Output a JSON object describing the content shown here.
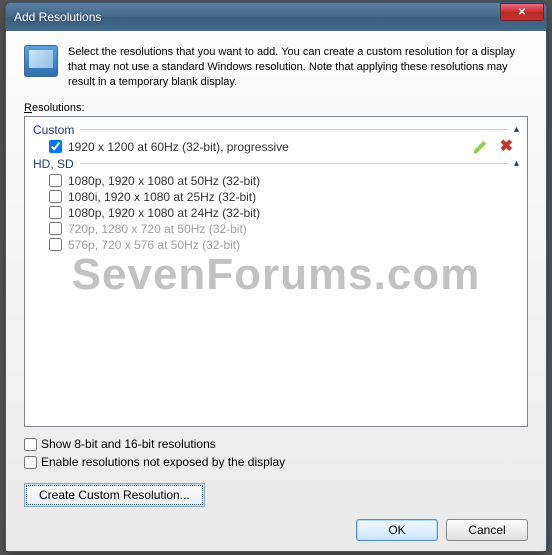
{
  "title": "Add Resolutions",
  "intro": "Select the resolutions that you want to add. You can create a custom resolution for a display that may not use a standard Windows resolution. Note that applying these resolutions may result in a temporary blank display.",
  "resolutions_label": "Resolutions:",
  "groups": {
    "custom": {
      "name": "Custom"
    },
    "hd_sd": {
      "name": "HD, SD"
    }
  },
  "custom_items": [
    {
      "label": "1920 x 1200 at 60Hz (32-bit), progressive",
      "checked": true
    }
  ],
  "hd_items": [
    {
      "label": "1080p, 1920 x 1080 at 50Hz (32-bit)",
      "dim": false
    },
    {
      "label": "1080i, 1920 x 1080 at 25Hz (32-bit)",
      "dim": false
    },
    {
      "label": "1080p, 1920 x 1080 at 24Hz (32-bit)",
      "dim": false
    },
    {
      "label": "720p, 1280 x 720 at 50Hz (32-bit)",
      "dim": true
    },
    {
      "label": "576p, 720 x 576 at 50Hz (32-bit)",
      "dim": true
    }
  ],
  "opts": {
    "show_8_16": "Show 8-bit and 16-bit resolutions",
    "expose": "Enable resolutions not exposed by the display"
  },
  "create_btn": "Create Custom Resolution...",
  "ok": "OK",
  "cancel": "Cancel",
  "watermark": "SevenForums.com"
}
